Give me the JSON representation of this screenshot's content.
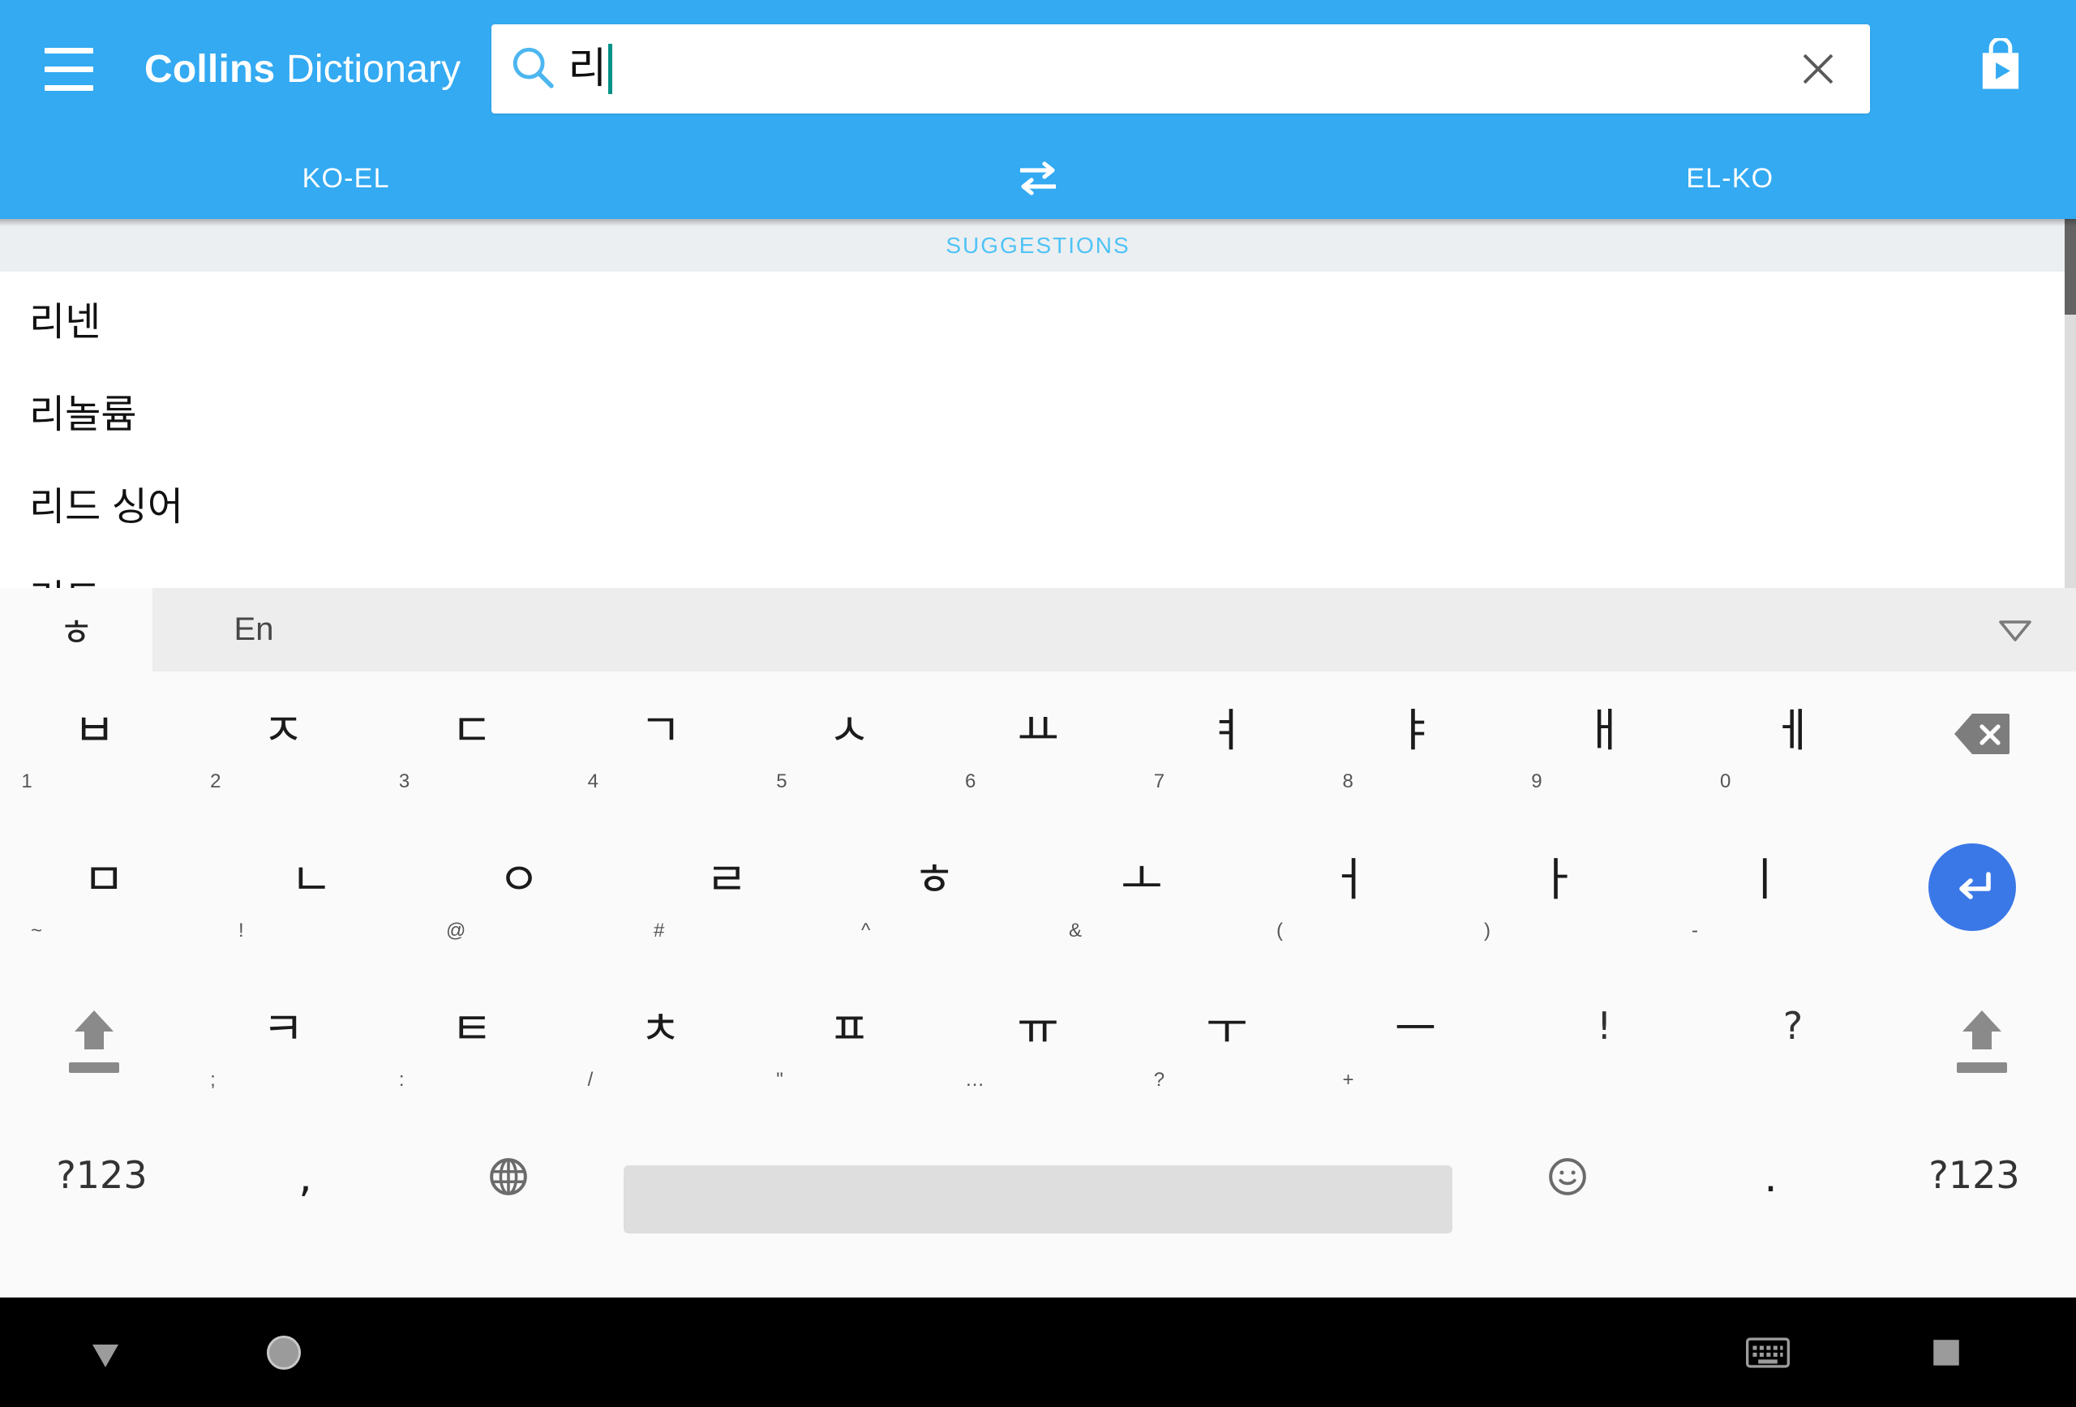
{
  "appbar": {
    "menu_icon": "hamburger-menu-icon",
    "brand_bold": "Collins",
    "brand_light": "Dictionary",
    "search_icon": "search-icon",
    "search_value": "리",
    "search_placeholder": "",
    "clear_icon": "close-icon",
    "store_icon": "play-store-bag-icon"
  },
  "lang_tabs": {
    "left": "KO-EL",
    "swap_icon": "swap-arrows-icon",
    "right": "EL-KO"
  },
  "suggestions": {
    "header": "SUGGESTIONS",
    "items": [
      {
        "text": "리넨"
      },
      {
        "text": "리놀륨"
      },
      {
        "text": "리드 싱어"
      },
      {
        "text": "리드"
      }
    ]
  },
  "keyboard": {
    "toolbar": {
      "tab_ko": "ㅎ",
      "tab_en": "En",
      "collapse_icon": "chevron-down-triangle-icon"
    },
    "rows": [
      [
        {
          "glyph": "ㅂ",
          "alt": "1"
        },
        {
          "glyph": "ㅈ",
          "alt": "2"
        },
        {
          "glyph": "ㄷ",
          "alt": "3"
        },
        {
          "glyph": "ㄱ",
          "alt": "4"
        },
        {
          "glyph": "ㅅ",
          "alt": "5"
        },
        {
          "glyph": "ㅛ",
          "alt": "6"
        },
        {
          "glyph": "ㅕ",
          "alt": "7"
        },
        {
          "glyph": "ㅑ",
          "alt": "8"
        },
        {
          "glyph": "ㅐ",
          "alt": "9"
        },
        {
          "glyph": "ㅔ",
          "alt": "0"
        },
        {
          "glyph": "",
          "alt": "",
          "name": "backspace-key"
        }
      ],
      [
        {
          "glyph": "ㅁ",
          "alt": "~"
        },
        {
          "glyph": "ㄴ",
          "alt": "!"
        },
        {
          "glyph": "ㅇ",
          "alt": "@"
        },
        {
          "glyph": "ㄹ",
          "alt": "#"
        },
        {
          "glyph": "ㅎ",
          "alt": "^"
        },
        {
          "glyph": "ㅗ",
          "alt": "&"
        },
        {
          "glyph": "ㅓ",
          "alt": "("
        },
        {
          "glyph": "ㅏ",
          "alt": ")"
        },
        {
          "glyph": "ㅣ",
          "alt": "-"
        },
        {
          "glyph": "",
          "alt": "",
          "name": "enter-key"
        }
      ],
      [
        {
          "glyph": "",
          "alt": "",
          "name": "shift-left-key"
        },
        {
          "glyph": "ㅋ",
          "alt": ";"
        },
        {
          "glyph": "ㅌ",
          "alt": ":"
        },
        {
          "glyph": "ㅊ",
          "alt": "/"
        },
        {
          "glyph": "ㅍ",
          "alt": "\""
        },
        {
          "glyph": "ㅠ",
          "alt": "…"
        },
        {
          "glyph": "ㅜ",
          "alt": "?"
        },
        {
          "glyph": "ㅡ",
          "alt": "+"
        },
        {
          "glyph": "!",
          "alt": ""
        },
        {
          "glyph": "?",
          "alt": ""
        },
        {
          "glyph": "",
          "alt": "",
          "name": "shift-right-key"
        }
      ],
      [
        {
          "glyph": "?123",
          "alt": "",
          "name": "symbols-left-key"
        },
        {
          "glyph": ",",
          "alt": "",
          "name": "comma-key"
        },
        {
          "glyph": "",
          "alt": "",
          "name": "language-globe-key"
        },
        {
          "glyph": "",
          "alt": "",
          "name": "space-key"
        },
        {
          "glyph": "",
          "alt": "",
          "name": "emoji-key"
        },
        {
          "glyph": ".",
          "alt": "",
          "name": "period-key"
        },
        {
          "glyph": "?123",
          "alt": "",
          "name": "symbols-right-key"
        }
      ]
    ]
  },
  "navbar": {
    "back_icon": "back-down-triangle-icon",
    "home_icon": "home-circle-icon",
    "keyboard_icon": "keyboard-icon",
    "recents_icon": "recents-square-icon"
  },
  "colors": {
    "brand_blue": "#33aaf2",
    "suggestion_header": "#4fc3f7",
    "enter_blue": "#3b78e7",
    "caret_teal": "#029287"
  }
}
